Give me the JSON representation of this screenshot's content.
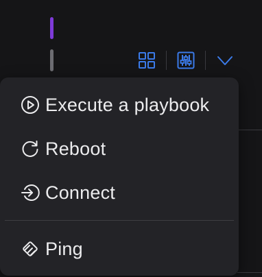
{
  "colors": {
    "background": "#151517",
    "menu_background": "#232327",
    "menu_text": "#ececee",
    "accent_blue": "#3b7bea",
    "indicator_active": "#7e3ad8",
    "indicator_inactive": "#6d6d72"
  },
  "toolbar": {
    "buttons": [
      {
        "icon": "grid-icon"
      },
      {
        "icon": "sliders-icon"
      },
      {
        "icon": "chevron-down-icon"
      }
    ]
  },
  "menu": {
    "items": [
      {
        "label": "Execute a playbook",
        "icon": "play-circle-icon"
      },
      {
        "label": "Reboot",
        "icon": "refresh-icon"
      },
      {
        "label": "Connect",
        "icon": "login-icon"
      },
      {
        "label": "Ping",
        "icon": "ping-icon"
      }
    ]
  }
}
